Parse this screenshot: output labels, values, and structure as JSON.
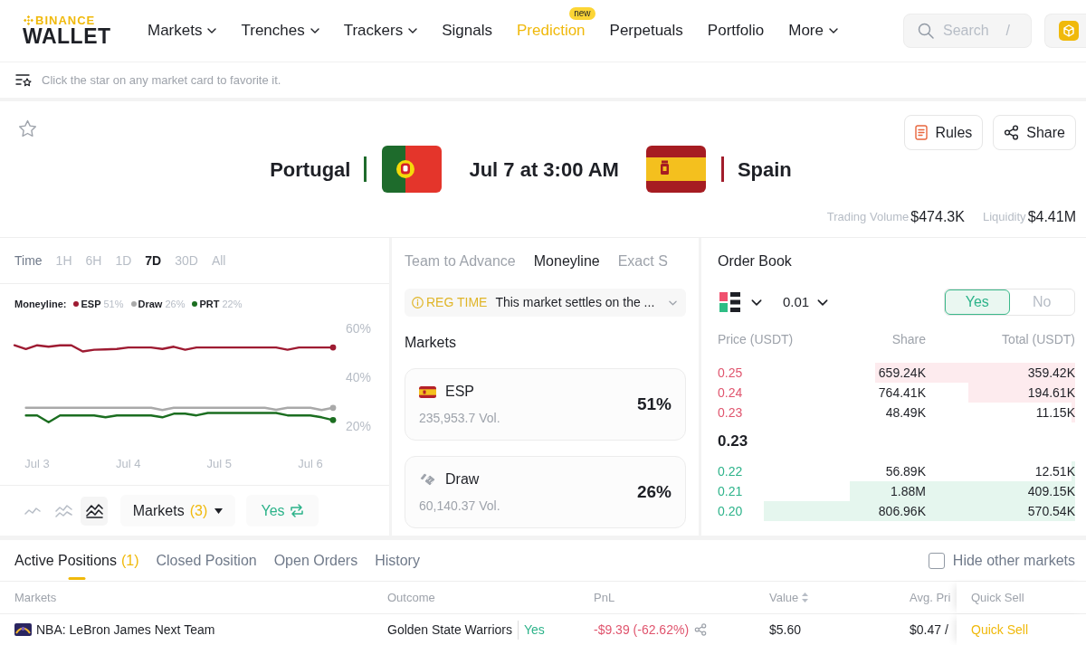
{
  "nav": {
    "logo_top": "BINANCE",
    "logo_bottom": "WALLET",
    "items": [
      {
        "label": "Markets",
        "dropdown": true,
        "selected": false
      },
      {
        "label": "Trenches",
        "dropdown": true,
        "selected": false
      },
      {
        "label": "Trackers",
        "dropdown": true,
        "selected": false
      },
      {
        "label": "Signals",
        "dropdown": false,
        "selected": false
      },
      {
        "label": "Prediction",
        "dropdown": false,
        "selected": true,
        "badge": "new"
      },
      {
        "label": "Perpetuals",
        "dropdown": false,
        "selected": false
      },
      {
        "label": "Portfolio",
        "dropdown": false,
        "selected": false
      },
      {
        "label": "More",
        "dropdown": true,
        "selected": false
      }
    ],
    "search": {
      "placeholder": "Search",
      "shortcut": "/"
    }
  },
  "hint": {
    "text": "Click the star on any market card to favorite it."
  },
  "match": {
    "favorite": false,
    "teams": [
      {
        "name": "Portugal",
        "kind": "portugal",
        "color": "#1f6b2c"
      },
      {
        "name": "Spain",
        "kind": "spain",
        "color": "#a11d2b"
      }
    ],
    "time": "Jul 7 at 3:00 AM",
    "buttons": [
      {
        "kind": "rules",
        "label": "Rules"
      },
      {
        "kind": "share",
        "label": "Share"
      }
    ],
    "stats": [
      {
        "label": "Trading Volume",
        "value": "$474.3K"
      },
      {
        "label": "Liquidity",
        "value": "$4.41M"
      }
    ]
  },
  "chart_panel": {
    "time_label": "Time",
    "ranges": [
      {
        "label": "1H",
        "selected": false
      },
      {
        "label": "6H",
        "selected": false
      },
      {
        "label": "1D",
        "selected": false
      },
      {
        "label": "7D",
        "selected": true
      },
      {
        "label": "30D",
        "selected": false
      },
      {
        "label": "All",
        "selected": false
      }
    ],
    "chart_data": [
      {
        "type": "line",
        "legend_title": "Moneyline:",
        "legend": "top",
        "categories": [
          null,
          null,
          "Jul 3",
          null,
          null,
          null,
          null,
          null,
          null,
          null,
          "Jul 4",
          null,
          null,
          null,
          null,
          null,
          null,
          null,
          "Jul 5",
          null,
          null,
          null,
          null,
          null,
          null,
          null,
          "Jul 6",
          null,
          null
        ],
        "ylim": [
          20,
          60
        ],
        "yticks": [
          {
            "value": 20,
            "label": "20%"
          },
          {
            "value": 40,
            "label": "40%"
          },
          {
            "value": 60,
            "label": "60%"
          }
        ],
        "series": [
          {
            "name": "ESP",
            "color": "#9e1b32",
            "values": [
              53,
              51.5,
              53,
              52.4,
              53,
              53,
              50.5,
              51.2,
              51.3,
              51.5,
              52.1,
              52.1,
              52.1,
              51.5,
              52.4,
              51.2,
              52.1,
              52.1,
              52.1,
              52.1,
              52.1,
              52.1,
              52.1,
              52.1,
              51.2,
              52.1,
              52.1,
              52.1,
              52.1
            ]
          },
          {
            "name": "Draw",
            "color": "#a9a9a9",
            "values": [
              null,
              27.4,
              27.4,
              27.4,
              27.4,
              27.4,
              27.4,
              27.4,
              27.4,
              27.4,
              27.4,
              27.4,
              27.4,
              26.5,
              27.4,
              27.4,
              27.4,
              27.4,
              27.4,
              27.4,
              27.4,
              27.4,
              27.4,
              26.6,
              27.4,
              27.4,
              27.4,
              26.5,
              27.4
            ]
          },
          {
            "name": "PRT",
            "color": "#1b6e20",
            "values": [
              null,
              24.3,
              24.3,
              21.5,
              24.3,
              24.3,
              24.3,
              24.3,
              23.5,
              24.3,
              24.3,
              24.3,
              24.3,
              23.5,
              25,
              25,
              24.3,
              25.3,
              25.3,
              25.3,
              25.3,
              25.3,
              25.3,
              25.3,
              24.3,
              24.3,
              24.3,
              23.5,
              22.4
            ]
          }
        ]
      }
    ],
    "legend_values": [
      "51%",
      "26%",
      "22%"
    ],
    "styles": [
      {
        "kind": "line",
        "selected": false
      },
      {
        "kind": "multiline",
        "selected": false
      },
      {
        "kind": "area",
        "selected": true
      }
    ],
    "markets_button": {
      "label": "Markets",
      "count": "(3)"
    },
    "side_button": {
      "label": "Yes"
    }
  },
  "markets_panel": {
    "tabs": [
      {
        "label": "Team to Advance",
        "selected": false
      },
      {
        "label": "Moneyline",
        "selected": true
      },
      {
        "label": "Exact S",
        "selected": false
      }
    ],
    "notice": {
      "tag": "REG TIME",
      "text": "This market settles on the ..."
    },
    "heading": "Markets",
    "markets": [
      {
        "kind": "flag",
        "name": "ESP",
        "volume": "235,953.7 Vol.",
        "chance": "51%"
      },
      {
        "kind": "draw",
        "name": "Draw",
        "volume": "60,140.37 Vol.",
        "chance": "26%"
      }
    ]
  },
  "order_book": {
    "title": "Order Book",
    "tick": "0.01",
    "sides": [
      {
        "label": "Yes",
        "selected": true
      },
      {
        "label": "No",
        "selected": false
      }
    ],
    "columns": [
      "Price (USDT)",
      "Share",
      "Total (USDT)"
    ],
    "asks": [
      {
        "price": "0.25",
        "share": "659.24K",
        "total": "359.42K",
        "level": 0.56
      },
      {
        "price": "0.24",
        "share": "764.41K",
        "total": "194.61K",
        "level": 0.3
      },
      {
        "price": "0.23",
        "share": "48.49K",
        "total": "11.15K",
        "level": 0.01
      }
    ],
    "mid_price": "0.23",
    "bids": [
      {
        "price": "0.22",
        "share": "56.89K",
        "total": "12.51K",
        "level": 0.01
      },
      {
        "price": "0.21",
        "share": "1.88M",
        "total": "409.15K",
        "level": 0.63
      },
      {
        "price": "0.20",
        "share": "806.96K",
        "total": "570.54K",
        "level": 0.87
      }
    ]
  },
  "positions": {
    "tabs": [
      {
        "label": "Active Positions",
        "count": "(1)",
        "selected": true
      },
      {
        "label": "Closed Position",
        "selected": false
      },
      {
        "label": "Open Orders",
        "selected": false
      },
      {
        "label": "History",
        "selected": false
      }
    ],
    "hide_other": {
      "label": "Hide other markets",
      "checked": false
    },
    "columns": [
      {
        "label": "Markets",
        "sortable": false
      },
      {
        "label": "Outcome",
        "sortable": false
      },
      {
        "label": "PnL",
        "sortable": false
      },
      {
        "label": "Value",
        "sortable": true
      },
      {
        "label": "Avg. Pri",
        "sortable": false
      },
      {
        "label": "Quick Sell",
        "sortable": false
      }
    ],
    "rows": [
      {
        "market": "NBA: LeBron James Next Team",
        "outcome": "Golden State Warriors",
        "side": "Yes",
        "pnl": "-$9.39 (-62.62%)",
        "value": "$5.60",
        "avg_price": "$0.47 /",
        "action": "Quick Sell"
      }
    ]
  }
}
